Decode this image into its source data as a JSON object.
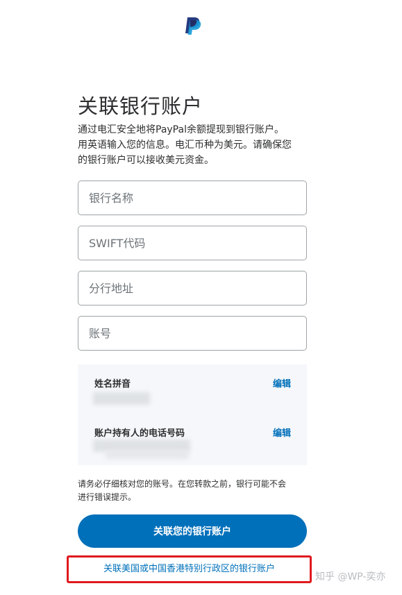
{
  "brand": {
    "logo_icon": "paypal-logo-icon",
    "primary_color": "#0070ba",
    "highlight_color": "#e0191e"
  },
  "page": {
    "title": "关联银行账户",
    "intro_line1": "通过电汇安全地将PayPal余额提现到银行账户。",
    "intro_line2": "用英语输入您的信息。电汇币种为美元。请确保您",
    "intro_line3": "的银行账户可以接收美元资金。"
  },
  "form": {
    "bank_name": {
      "placeholder": "银行名称",
      "value": ""
    },
    "swift_code": {
      "placeholder": "SWIFT代码",
      "value": ""
    },
    "branch_address": {
      "placeholder": "分行地址",
      "value": ""
    },
    "account_number": {
      "placeholder": "账号",
      "value": ""
    }
  },
  "account_holder": {
    "name_label": "姓名拼音",
    "name_edit": "编辑",
    "phone_label": "账户持有人的电话号码",
    "phone_edit": "编辑"
  },
  "notice": {
    "line1": "请务必仔细核对您的账号。在您转款之前，银行可能不会",
    "line2": "进行错误提示。"
  },
  "actions": {
    "link_account_button": "关联您的银行账户",
    "alt_link": "关联美国或中国香港特别行政区的银行账户"
  },
  "watermark": "知乎 @WP-奕亦"
}
